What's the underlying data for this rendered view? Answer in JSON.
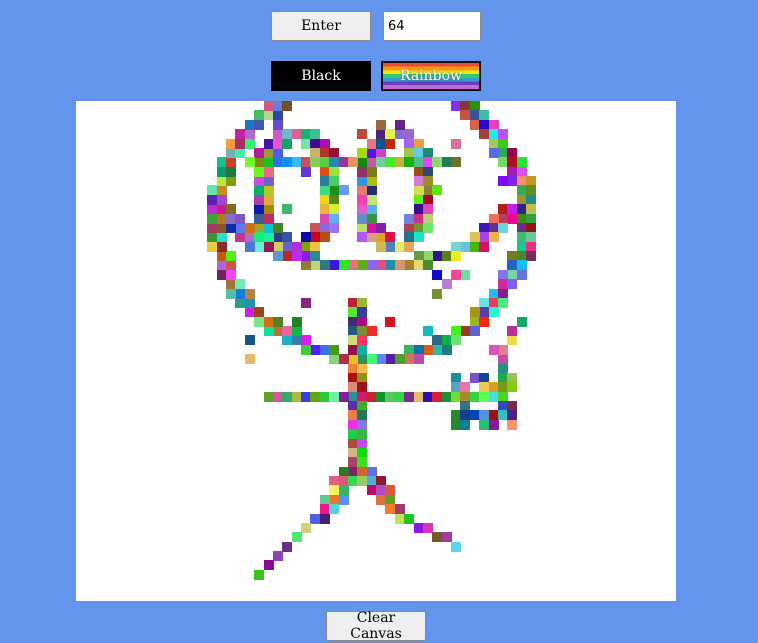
{
  "controls": {
    "enter_label": "Enter",
    "grid_size_value": "64",
    "black_label": "Black",
    "rainbow_label": "Rainbow",
    "clear_label": "Clear Canvas"
  },
  "colors": {
    "page_background": "#6495ED",
    "canvas_background": "#FFFFFF",
    "black_button": "#000000"
  }
}
